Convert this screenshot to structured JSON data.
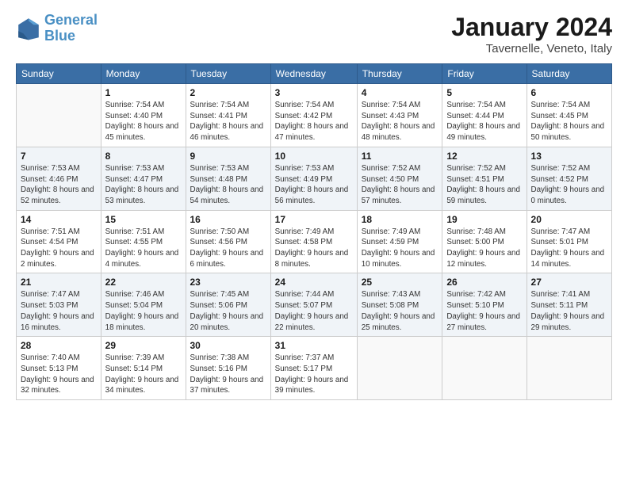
{
  "header": {
    "logo_line1": "General",
    "logo_line2": "Blue",
    "month": "January 2024",
    "location": "Tavernelle, Veneto, Italy"
  },
  "weekdays": [
    "Sunday",
    "Monday",
    "Tuesday",
    "Wednesday",
    "Thursday",
    "Friday",
    "Saturday"
  ],
  "weeks": [
    [
      {
        "day": "",
        "sunrise": "",
        "sunset": "",
        "daylight": ""
      },
      {
        "day": "1",
        "sunrise": "Sunrise: 7:54 AM",
        "sunset": "Sunset: 4:40 PM",
        "daylight": "Daylight: 8 hours and 45 minutes."
      },
      {
        "day": "2",
        "sunrise": "Sunrise: 7:54 AM",
        "sunset": "Sunset: 4:41 PM",
        "daylight": "Daylight: 8 hours and 46 minutes."
      },
      {
        "day": "3",
        "sunrise": "Sunrise: 7:54 AM",
        "sunset": "Sunset: 4:42 PM",
        "daylight": "Daylight: 8 hours and 47 minutes."
      },
      {
        "day": "4",
        "sunrise": "Sunrise: 7:54 AM",
        "sunset": "Sunset: 4:43 PM",
        "daylight": "Daylight: 8 hours and 48 minutes."
      },
      {
        "day": "5",
        "sunrise": "Sunrise: 7:54 AM",
        "sunset": "Sunset: 4:44 PM",
        "daylight": "Daylight: 8 hours and 49 minutes."
      },
      {
        "day": "6",
        "sunrise": "Sunrise: 7:54 AM",
        "sunset": "Sunset: 4:45 PM",
        "daylight": "Daylight: 8 hours and 50 minutes."
      }
    ],
    [
      {
        "day": "7",
        "sunrise": "Sunrise: 7:53 AM",
        "sunset": "Sunset: 4:46 PM",
        "daylight": "Daylight: 8 hours and 52 minutes."
      },
      {
        "day": "8",
        "sunrise": "Sunrise: 7:53 AM",
        "sunset": "Sunset: 4:47 PM",
        "daylight": "Daylight: 8 hours and 53 minutes."
      },
      {
        "day": "9",
        "sunrise": "Sunrise: 7:53 AM",
        "sunset": "Sunset: 4:48 PM",
        "daylight": "Daylight: 8 hours and 54 minutes."
      },
      {
        "day": "10",
        "sunrise": "Sunrise: 7:53 AM",
        "sunset": "Sunset: 4:49 PM",
        "daylight": "Daylight: 8 hours and 56 minutes."
      },
      {
        "day": "11",
        "sunrise": "Sunrise: 7:52 AM",
        "sunset": "Sunset: 4:50 PM",
        "daylight": "Daylight: 8 hours and 57 minutes."
      },
      {
        "day": "12",
        "sunrise": "Sunrise: 7:52 AM",
        "sunset": "Sunset: 4:51 PM",
        "daylight": "Daylight: 8 hours and 59 minutes."
      },
      {
        "day": "13",
        "sunrise": "Sunrise: 7:52 AM",
        "sunset": "Sunset: 4:52 PM",
        "daylight": "Daylight: 9 hours and 0 minutes."
      }
    ],
    [
      {
        "day": "14",
        "sunrise": "Sunrise: 7:51 AM",
        "sunset": "Sunset: 4:54 PM",
        "daylight": "Daylight: 9 hours and 2 minutes."
      },
      {
        "day": "15",
        "sunrise": "Sunrise: 7:51 AM",
        "sunset": "Sunset: 4:55 PM",
        "daylight": "Daylight: 9 hours and 4 minutes."
      },
      {
        "day": "16",
        "sunrise": "Sunrise: 7:50 AM",
        "sunset": "Sunset: 4:56 PM",
        "daylight": "Daylight: 9 hours and 6 minutes."
      },
      {
        "day": "17",
        "sunrise": "Sunrise: 7:49 AM",
        "sunset": "Sunset: 4:58 PM",
        "daylight": "Daylight: 9 hours and 8 minutes."
      },
      {
        "day": "18",
        "sunrise": "Sunrise: 7:49 AM",
        "sunset": "Sunset: 4:59 PM",
        "daylight": "Daylight: 9 hours and 10 minutes."
      },
      {
        "day": "19",
        "sunrise": "Sunrise: 7:48 AM",
        "sunset": "Sunset: 5:00 PM",
        "daylight": "Daylight: 9 hours and 12 minutes."
      },
      {
        "day": "20",
        "sunrise": "Sunrise: 7:47 AM",
        "sunset": "Sunset: 5:01 PM",
        "daylight": "Daylight: 9 hours and 14 minutes."
      }
    ],
    [
      {
        "day": "21",
        "sunrise": "Sunrise: 7:47 AM",
        "sunset": "Sunset: 5:03 PM",
        "daylight": "Daylight: 9 hours and 16 minutes."
      },
      {
        "day": "22",
        "sunrise": "Sunrise: 7:46 AM",
        "sunset": "Sunset: 5:04 PM",
        "daylight": "Daylight: 9 hours and 18 minutes."
      },
      {
        "day": "23",
        "sunrise": "Sunrise: 7:45 AM",
        "sunset": "Sunset: 5:06 PM",
        "daylight": "Daylight: 9 hours and 20 minutes."
      },
      {
        "day": "24",
        "sunrise": "Sunrise: 7:44 AM",
        "sunset": "Sunset: 5:07 PM",
        "daylight": "Daylight: 9 hours and 22 minutes."
      },
      {
        "day": "25",
        "sunrise": "Sunrise: 7:43 AM",
        "sunset": "Sunset: 5:08 PM",
        "daylight": "Daylight: 9 hours and 25 minutes."
      },
      {
        "day": "26",
        "sunrise": "Sunrise: 7:42 AM",
        "sunset": "Sunset: 5:10 PM",
        "daylight": "Daylight: 9 hours and 27 minutes."
      },
      {
        "day": "27",
        "sunrise": "Sunrise: 7:41 AM",
        "sunset": "Sunset: 5:11 PM",
        "daylight": "Daylight: 9 hours and 29 minutes."
      }
    ],
    [
      {
        "day": "28",
        "sunrise": "Sunrise: 7:40 AM",
        "sunset": "Sunset: 5:13 PM",
        "daylight": "Daylight: 9 hours and 32 minutes."
      },
      {
        "day": "29",
        "sunrise": "Sunrise: 7:39 AM",
        "sunset": "Sunset: 5:14 PM",
        "daylight": "Daylight: 9 hours and 34 minutes."
      },
      {
        "day": "30",
        "sunrise": "Sunrise: 7:38 AM",
        "sunset": "Sunset: 5:16 PM",
        "daylight": "Daylight: 9 hours and 37 minutes."
      },
      {
        "day": "31",
        "sunrise": "Sunrise: 7:37 AM",
        "sunset": "Sunset: 5:17 PM",
        "daylight": "Daylight: 9 hours and 39 minutes."
      },
      {
        "day": "",
        "sunrise": "",
        "sunset": "",
        "daylight": ""
      },
      {
        "day": "",
        "sunrise": "",
        "sunset": "",
        "daylight": ""
      },
      {
        "day": "",
        "sunrise": "",
        "sunset": "",
        "daylight": ""
      }
    ]
  ]
}
